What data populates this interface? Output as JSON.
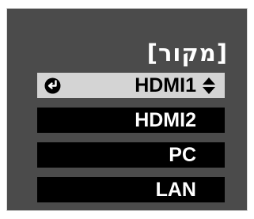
{
  "menu": {
    "title": "[מקור]",
    "items": [
      {
        "label": "HDMI1",
        "selected": true,
        "icons": [
          "enter-icon",
          "up-down-arrows-icon"
        ]
      },
      {
        "label": "HDMI2",
        "selected": false
      },
      {
        "label": "PC",
        "selected": false
      },
      {
        "label": "LAN",
        "selected": false
      }
    ]
  },
  "colors": {
    "panel_background": "#4b4b4b",
    "item_background": "#000000",
    "selected_background": "#d4d4d4",
    "text": "#ffffff",
    "selected_text": "#000000"
  }
}
